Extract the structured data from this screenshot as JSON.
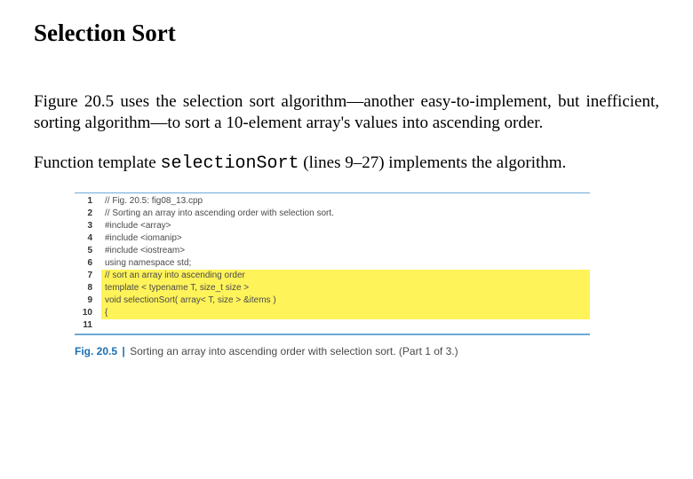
{
  "title": "Selection Sort",
  "para1_a": "Figure 20.5 uses the ",
  "para1_b": "selection sort",
  "para1_c": " algorithm—another easy-to-implement, but inefficient, sorting algorithm—to sort a 10-element array's values into ascending order.",
  "para2_a": "Function template ",
  "para2_code": "selectionSort",
  "para2_b": " (lines 9–27) implements the algorithm.",
  "code": {
    "nums": [
      "1",
      "2",
      "3",
      "4",
      "5",
      "6",
      "7",
      "8",
      "9",
      "10",
      "11"
    ],
    "lines": {
      "l1": "// Fig. 20.5: fig08_13.cpp",
      "l2": "// Sorting an array into ascending order with selection sort.",
      "l3": "#include <array>",
      "l4": "#include <iomanip>",
      "l5": "#include <iostream>",
      "l6": "using namespace std;",
      "l7": "",
      "l8": "// sort an array into ascending order",
      "l9": "template < typename T, size_t size >",
      "l10": "void selectionSort( array< T, size > &items )",
      "l11": "{"
    }
  },
  "caption": {
    "label": "Fig. 20.5",
    "bar": "|",
    "text": " Sorting an array into ascending order with selection sort. (Part 1 of 3.)"
  }
}
